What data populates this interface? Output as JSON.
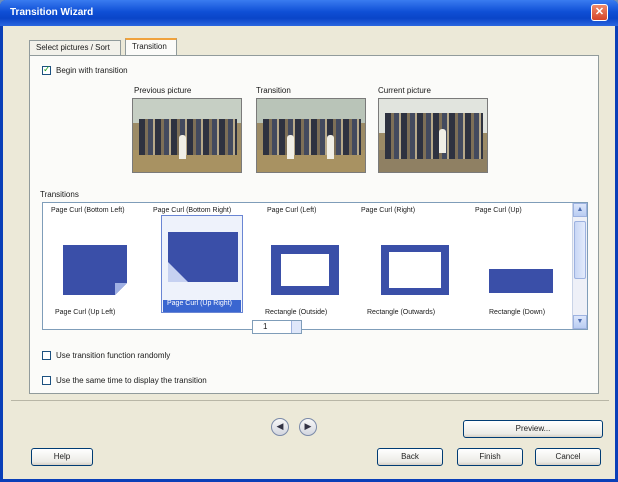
{
  "window": {
    "title": "Transition Wizard"
  },
  "tabs": [
    {
      "label": "Select pictures / Sort"
    },
    {
      "label": "Transition"
    }
  ],
  "options": {
    "begin_with_transition": "Begin with transition",
    "assign_transitions_randomly": "Use transition function randomly",
    "use_same_duration": "Use the same time to display the transition",
    "duration_value": "1"
  },
  "previews": {
    "previous_label": "Previous picture",
    "transition_label": "Transition",
    "current_label": "Current picture"
  },
  "transitions": {
    "section_label": "Transitions",
    "top_labels": [
      "Page Curl (Bottom Left)",
      "Page Curl (Bottom Right)",
      "Page Curl (Left)",
      "Page Curl (Right)",
      "Page Curl (Up)"
    ],
    "items": [
      {
        "label": "Page Curl (Up Left)"
      },
      {
        "label": "Page Curl (Up Right)",
        "selected": true
      },
      {
        "label": "Rectangle (Outside)"
      },
      {
        "label": "Rectangle (Outwards)"
      },
      {
        "label": "Rectangle (Down)"
      }
    ]
  },
  "buttons": {
    "help": "Help",
    "preview": "Preview...",
    "back": "Back",
    "finish": "Finish",
    "cancel": "Cancel"
  }
}
